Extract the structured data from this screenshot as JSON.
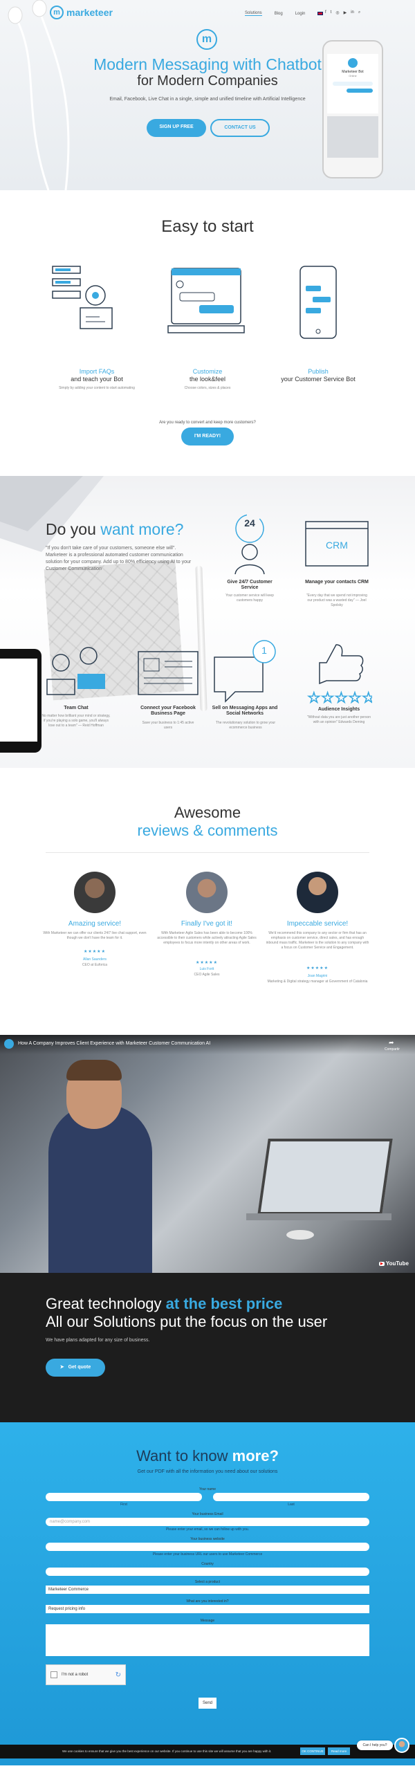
{
  "colors": {
    "brand_blue": "#39a9e0",
    "dark_band": "#1d1d1d",
    "form_bg": "#26aee8"
  },
  "header": {
    "logo_text": "marketeer",
    "nav": [
      "Solutions",
      "Blog",
      "Login"
    ],
    "flag_icon": "uk-flag-icon",
    "social_icons": [
      "facebook-icon",
      "twitter-icon",
      "instagram-icon",
      "youtube-icon",
      "linkedin-icon",
      "search-icon"
    ]
  },
  "hero": {
    "title_line1": "Modern Messaging with Chatbot",
    "title_line2": "for Modern Companies",
    "subtitle": "Email, Facebook, Live Chat in a single, simple and unified timeline with Artificial Intelligence",
    "signup_label": "SIGN UP FREE",
    "contact_label": "CONTACT US",
    "phone": {
      "chat_name": "Marketeer Bot",
      "chat_status": "Online"
    }
  },
  "easy": {
    "title": "Easy to start",
    "steps": [
      {
        "title_a": "Import FAQs",
        "title_b": "and teach your Bot",
        "desc": "Simply by adding your content to start automating"
      },
      {
        "title_a": "Customize",
        "title_b": "the look&feel",
        "desc": "Choose colors, sizes & places"
      },
      {
        "title_a": "Publish",
        "title_b": "your Customer Service Bot",
        "desc": ""
      }
    ],
    "cta_question": "Are you ready to convert and keep more customers?",
    "cta_label": "I'M READY!"
  },
  "more": {
    "title_plain": "Do you",
    "title_blue": "want more?",
    "text": "\"If you don't take care of your customers, someone else will\". Marketeer is a professional automated customer communication solution for your company. Add up to 80% efficiency using AI to your Customer Communication",
    "crm_text": "CRM",
    "badge_24": "24",
    "badge_1": "1",
    "features": [
      {
        "title": "Give 24/7 Customer Service",
        "desc": "Your customer service will keep customers happy"
      },
      {
        "title": "Manage your contacts CRM",
        "desc": "\"Every day that we spend not improving our product was a wasted day\" — Joel Spolsky"
      },
      {
        "title": "Team Chat",
        "desc": "No matter how brilliant your mind or strategy, if you're playing a solo game, you'll always lose out to a team\" — Reid Hoffman"
      },
      {
        "title": "Connect your Facebook Business Page",
        "desc": "Save your business to 1:45 active users"
      },
      {
        "title": "Sell on Messaging Apps and Social Networks",
        "desc": "The revolutionary solution to grow your ecommerce business"
      },
      {
        "title": "Audience Insights",
        "desc": "\"Without data you are just another person with an opinion\" Edwards Deming"
      }
    ]
  },
  "reviews": {
    "title_line1": "Awesome",
    "title_line2": "reviews & comments",
    "items": [
      {
        "title": "Amazing service!",
        "text": "With Marketeer we can offer our clients 24/7 live chat support, even though we don't have the team for it.",
        "stars": "★★★★★",
        "author": "Allan Saunders",
        "role": "CEO at Euforica"
      },
      {
        "title": "Finally I've got it!",
        "text": "With Marketeer Agile Sales has been able to become 100% accessible to their customers while actively attracting Agile Sales employees to focus more intently on other areas of work.",
        "stars": "★★★★★",
        "author": "Luis Fortt",
        "role": "CEO Agile Sales"
      },
      {
        "title": "Impeccable service!",
        "text": "We'd recommend this company to any sector or firm that has an emphasis on customer service, direct sales, and has enough inbound mass traffic. Marketeer is the solution to any company with a focus on Customer Service and Engagement.",
        "stars": "★★★★★",
        "author": "Joan Magrini",
        "role": "Marketing & Digital strategy manager at Government of Catalonia"
      }
    ]
  },
  "video": {
    "title": "How A Company Improves Client Experience with Marketeer Customer Communication AI",
    "share_label": "Compartir",
    "youtube_label": "YouTube"
  },
  "pricing": {
    "line1_plain": "Great technology",
    "line1_blue": "at the best price",
    "line2": "All our Solutions put the focus on the user",
    "subtitle": "We have plans adapted for any size of business.",
    "button_label": "Get quote"
  },
  "form": {
    "title_plain": "Want to know",
    "title_bold": "more?",
    "subtitle": "Get our PDF with all the information you need about our solutions",
    "name_label": "Your name",
    "first_hint": "First",
    "last_hint": "Last",
    "email_label": "Your business Email",
    "email_placeholder": "name@company.com",
    "email_hint": "Please enter your email, so we can follow up with you.",
    "website_label": "Your business website",
    "website_hint": "Please enter your business URL our users to use Marketeer Commerce",
    "country_label": "Country",
    "product_label": "Select a product",
    "product_value": "Marketeer Commerce",
    "interest_label": "What are you interested in?",
    "interest_value": "Request pricing info",
    "message_label": "Message",
    "captcha_label": "I'm not a robot",
    "send_label": "Send"
  },
  "cookie": {
    "text": "We use cookies to ensure that we give you the best experience on our website. If you continue to use this site we will assume that you are happy with it.",
    "ok_label": "OK CONTINUE",
    "read_label": "Read more"
  },
  "chat_widget": {
    "label": "Can I help you?"
  }
}
